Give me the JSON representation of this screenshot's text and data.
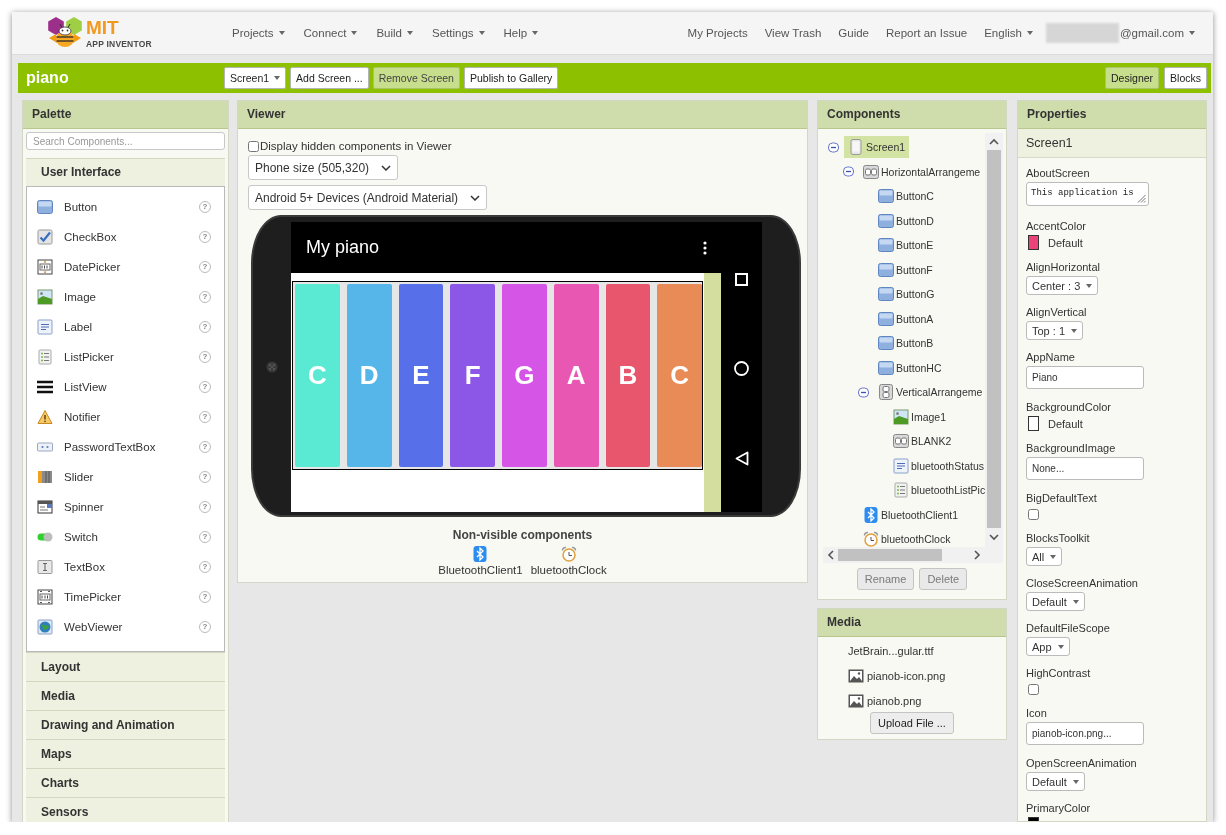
{
  "header": {
    "logo": {
      "title": "MIT",
      "subtitle": "APP INVENTOR"
    },
    "menus": [
      {
        "label": "Projects"
      },
      {
        "label": "Connect"
      },
      {
        "label": "Build"
      },
      {
        "label": "Settings"
      },
      {
        "label": "Help"
      }
    ],
    "links": [
      {
        "label": "My Projects"
      },
      {
        "label": "View Trash"
      },
      {
        "label": "Guide"
      },
      {
        "label": "Report an Issue"
      }
    ],
    "language": {
      "label": "English"
    },
    "account": {
      "label": "@gmail.com",
      "redacted": true
    }
  },
  "project_bar": {
    "name": "piano",
    "buttons": [
      {
        "label": "Screen1",
        "kind": "dropdown",
        "disabled": false
      },
      {
        "label": "Add Screen ...",
        "kind": "button",
        "disabled": false
      },
      {
        "label": "Remove Screen",
        "kind": "button",
        "disabled": true
      },
      {
        "label": "Publish to Gallery",
        "kind": "button",
        "disabled": false
      }
    ],
    "views": [
      {
        "label": "Designer",
        "selected": true
      },
      {
        "label": "Blocks",
        "selected": false
      }
    ]
  },
  "palette": {
    "title": "Palette",
    "search": {
      "placeholder": "Search Components..."
    },
    "categories": [
      {
        "label": "User Interface",
        "expanded": true,
        "items": [
          {
            "label": "Button",
            "kind": "button",
            "help": "?"
          },
          {
            "label": "CheckBox",
            "kind": "checkbox",
            "help": "?"
          },
          {
            "label": "DatePicker",
            "kind": "datepicker",
            "help": "?"
          },
          {
            "label": "Image",
            "kind": "image",
            "help": "?"
          },
          {
            "label": "Label",
            "kind": "label",
            "help": "?"
          },
          {
            "label": "ListPicker",
            "kind": "listpicker",
            "help": "?"
          },
          {
            "label": "ListView",
            "kind": "listview",
            "help": "?"
          },
          {
            "label": "Notifier",
            "kind": "notifier",
            "help": "?"
          },
          {
            "label": "PasswordTextBox",
            "kind": "password",
            "help": "?"
          },
          {
            "label": "Slider",
            "kind": "slider",
            "help": "?"
          },
          {
            "label": "Spinner",
            "kind": "spinner",
            "help": "?"
          },
          {
            "label": "Switch",
            "kind": "switch",
            "help": "?"
          },
          {
            "label": "TextBox",
            "kind": "textbox",
            "help": "?"
          },
          {
            "label": "TimePicker",
            "kind": "timepicker",
            "help": "?"
          },
          {
            "label": "WebViewer",
            "kind": "webviewer",
            "help": "?"
          }
        ]
      },
      {
        "label": "Layout",
        "expanded": false
      },
      {
        "label": "Media",
        "expanded": false
      },
      {
        "label": "Drawing and Animation",
        "expanded": false
      },
      {
        "label": "Maps",
        "expanded": false
      },
      {
        "label": "Charts",
        "expanded": false
      },
      {
        "label": "Sensors",
        "expanded": false
      }
    ]
  },
  "viewer": {
    "title": "Viewer",
    "hidden_toggle": {
      "label": "Display hidden components in Viewer",
      "checked": false
    },
    "dropdowns": [
      {
        "value": "Phone size (505,320)"
      },
      {
        "value": "Android 5+ Devices (Android Material)"
      }
    ],
    "phone": {
      "app_title": "My piano",
      "keys": [
        {
          "label": "C",
          "color": "#5aead4"
        },
        {
          "label": "D",
          "color": "#56b6e9"
        },
        {
          "label": "E",
          "color": "#576fe9"
        },
        {
          "label": "F",
          "color": "#8c57e6"
        },
        {
          "label": "G",
          "color": "#d455e6"
        },
        {
          "label": "A",
          "color": "#e858b2"
        },
        {
          "label": "B",
          "color": "#e8566e"
        },
        {
          "label": "C",
          "color": "#e88b56"
        }
      ]
    },
    "non_visible": {
      "title": "Non-visible components",
      "items": [
        {
          "label": "BluetoothClient1",
          "kind": "bluetooth"
        },
        {
          "label": "bluetoothClock",
          "kind": "clock"
        }
      ]
    }
  },
  "components": {
    "title": "Components",
    "tree": [
      {
        "label": "Screen1",
        "kind": "screen",
        "selected": true,
        "expanded": true,
        "children": [
          {
            "label": "HorizontalArrangeme",
            "kind": "horizontal-arrangement",
            "selected": false,
            "expanded": true,
            "children": [
              {
                "label": "ButtonC",
                "kind": "button",
                "selected": false
              },
              {
                "label": "ButtonD",
                "kind": "button",
                "selected": false
              },
              {
                "label": "ButtonE",
                "kind": "button",
                "selected": false
              },
              {
                "label": "ButtonF",
                "kind": "button",
                "selected": false
              },
              {
                "label": "ButtonG",
                "kind": "button",
                "selected": false
              },
              {
                "label": "ButtonA",
                "kind": "button",
                "selected": false
              },
              {
                "label": "ButtonB",
                "kind": "button",
                "selected": false
              },
              {
                "label": "ButtonHC",
                "kind": "button",
                "selected": false
              },
              {
                "label": "VerticalArrangeme",
                "kind": "vertical-arrangement",
                "selected": false,
                "expanded": true,
                "children": [
                  {
                    "label": "Image1",
                    "kind": "image",
                    "selected": false
                  },
                  {
                    "label": "BLANK2",
                    "kind": "horizontal-arrangement",
                    "selected": false
                  },
                  {
                    "label": "bluetoothStatus",
                    "kind": "label",
                    "selected": false
                  },
                  {
                    "label": "bluetoothListPic",
                    "kind": "listpicker",
                    "selected": false
                  }
                ]
              }
            ]
          },
          {
            "label": "BluetoothClient1",
            "kind": "bluetooth",
            "selected": false
          },
          {
            "label": "bluetoothClock",
            "kind": "clock",
            "selected": false
          }
        ]
      }
    ],
    "buttons": [
      {
        "label": "Rename",
        "disabled": true
      },
      {
        "label": "Delete",
        "disabled": true
      }
    ]
  },
  "media": {
    "title": "Media",
    "items": [
      {
        "label": "JetBrain...gular.ttf",
        "kind": "font"
      },
      {
        "label": "pianob-icon.png",
        "kind": "image"
      },
      {
        "label": "pianob.png",
        "kind": "image"
      }
    ],
    "upload_button": {
      "label": "Upload File ..."
    }
  },
  "properties": {
    "title": "Properties",
    "component": "Screen1",
    "items": [
      {
        "label": "AboutScreen",
        "kind": "textarea",
        "value": "This application is"
      },
      {
        "label": "AccentColor",
        "kind": "color",
        "value": "Default",
        "color": "#ec4279"
      },
      {
        "label": "AlignHorizontal",
        "kind": "select",
        "value": "Center : 3"
      },
      {
        "label": "AlignVertical",
        "kind": "select",
        "value": "Top : 1"
      },
      {
        "label": "AppName",
        "kind": "text",
        "value": "Piano"
      },
      {
        "label": "BackgroundColor",
        "kind": "color",
        "value": "Default",
        "color": "#ffffff"
      },
      {
        "label": "BackgroundImage",
        "kind": "text",
        "value": "None..."
      },
      {
        "label": "BigDefaultText",
        "kind": "checkbox",
        "checked": false
      },
      {
        "label": "BlocksToolkit",
        "kind": "select",
        "value": "All"
      },
      {
        "label": "CloseScreenAnimation",
        "kind": "select",
        "value": "Default"
      },
      {
        "label": "DefaultFileScope",
        "kind": "select",
        "value": "App"
      },
      {
        "label": "HighContrast",
        "kind": "checkbox",
        "checked": false
      },
      {
        "label": "Icon",
        "kind": "text",
        "value": "pianob-icon.png..."
      },
      {
        "label": "OpenScreenAnimation",
        "kind": "select",
        "value": "Default"
      },
      {
        "label": "PrimaryColor",
        "kind": "color",
        "color": "#000000"
      }
    ]
  }
}
